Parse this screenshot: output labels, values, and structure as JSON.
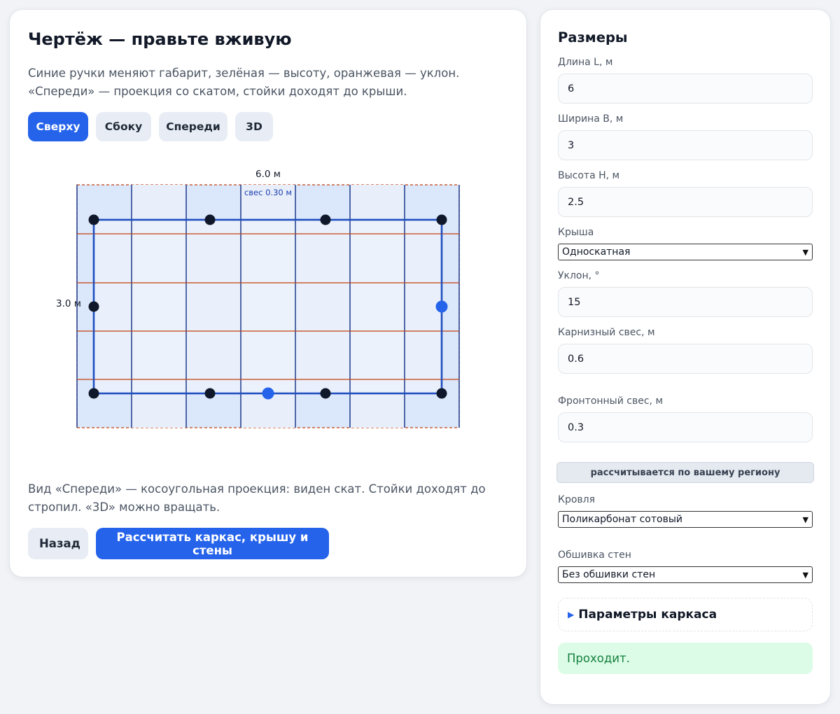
{
  "drawing_panel": {
    "title": "Чертёж — правьте вживую",
    "description": "Синие ручки меняют габарит, зелёная — высоту, оранжевая — уклон. «Спереди» — проекция со скатом, стойки доходят до крыши.",
    "tabs": [
      {
        "label": "Сверху",
        "active": true
      },
      {
        "label": "Сбоку",
        "active": false
      },
      {
        "label": "Спереди",
        "active": false
      },
      {
        "label": "3D",
        "active": false
      }
    ],
    "drawing": {
      "length_label": "6.0 м",
      "width_label": "3.0 м",
      "overhang_label": "свес 0.30 м"
    },
    "footnote": "Вид «Спереди» — косоугольная проекция: виден скат. Стойки доходят до стропил. «3D» можно вращать.",
    "back_button": "Назад",
    "calculate_button": "Рассчитать каркас, крышу и стены"
  },
  "dimensions_panel": {
    "title": "Размеры",
    "length": {
      "label": "Длина L, м",
      "value": "6"
    },
    "width": {
      "label": "Ширина B, м",
      "value": "3"
    },
    "height": {
      "label": "Высота H, м",
      "value": "2.5"
    },
    "roof": {
      "label": "Крыша",
      "value": "Односкатная"
    },
    "slope": {
      "label": "Уклон, °",
      "value": "15"
    },
    "eave_overhang": {
      "label": "Карнизный свес, м",
      "value": "0.6"
    },
    "gable_overhang": {
      "label": "Фронтонный свес, м",
      "value": "0.3"
    },
    "region_note": "рассчитывается по вашему региону",
    "roofing": {
      "label": "Кровля",
      "value": "Поликарбонат сотовый"
    },
    "wall_cladding": {
      "label": "Обшивка стен",
      "value": "Без обшивки стен"
    },
    "frame_params": "Параметры каркаса",
    "status": "Проходит."
  },
  "colors": {
    "accent": "#2563eb",
    "roof_fill": "#dbe7fb",
    "frame_line": "#1f4fbf",
    "purlin_line": "#c2410c",
    "post_dot": "#0f172a",
    "status_bg": "#dcfce7",
    "status_text": "#15803d"
  }
}
